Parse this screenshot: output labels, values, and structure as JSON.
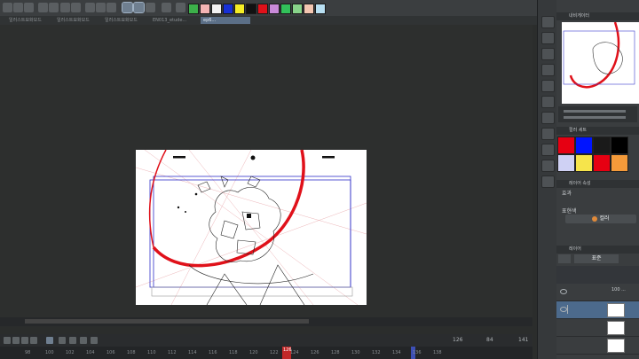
{
  "tabs": [
    {
      "label": "일러스트묘화모드"
    },
    {
      "label": "일러스트묘화모드"
    },
    {
      "label": "일러스트묘화모드"
    },
    {
      "label": "EN013_etude..."
    },
    {
      "label": "ep6..."
    }
  ],
  "colors": {
    "accent": "#5b6f87",
    "stroke_red": "#e0111a",
    "timeline_marker": "#c12828",
    "swatches": [
      "#3cb04a",
      "#f3b4b4",
      "#f2f2f2",
      "#1730d6",
      "#f5ee25",
      "#111111",
      "#e0111a",
      "#c98ad9",
      "#32c15a",
      "#88d38a",
      "#f3c6b1",
      "#b8dff2"
    ]
  },
  "navigator": {
    "title": "내비게이터"
  },
  "color_set": {
    "title": "컬러 세트",
    "cells": [
      "#e60012",
      "#0014ff",
      "#1a1a1a",
      "#000000",
      "#cfd1f4",
      "#f6e44b",
      "#e60012",
      "#f49a3a"
    ]
  },
  "tool_property": {
    "title": "레이어 속성",
    "effect_label": "효과",
    "expression_label": "표현색",
    "expression_value": "컬러"
  },
  "layers_panel": {
    "title": "레이어",
    "blend_mode": "표준",
    "folder_label": "100 ..."
  },
  "timeline": {
    "frames": [
      "98",
      "100",
      "102",
      "104",
      "106",
      "108",
      "110",
      "112",
      "114",
      "116",
      "118",
      "120",
      "122",
      "124",
      "126",
      "128",
      "130",
      "132",
      "134",
      "136",
      "138"
    ],
    "current_frame": "126",
    "readout_current": "126",
    "readout_total": "84",
    "readout_end": "141"
  }
}
